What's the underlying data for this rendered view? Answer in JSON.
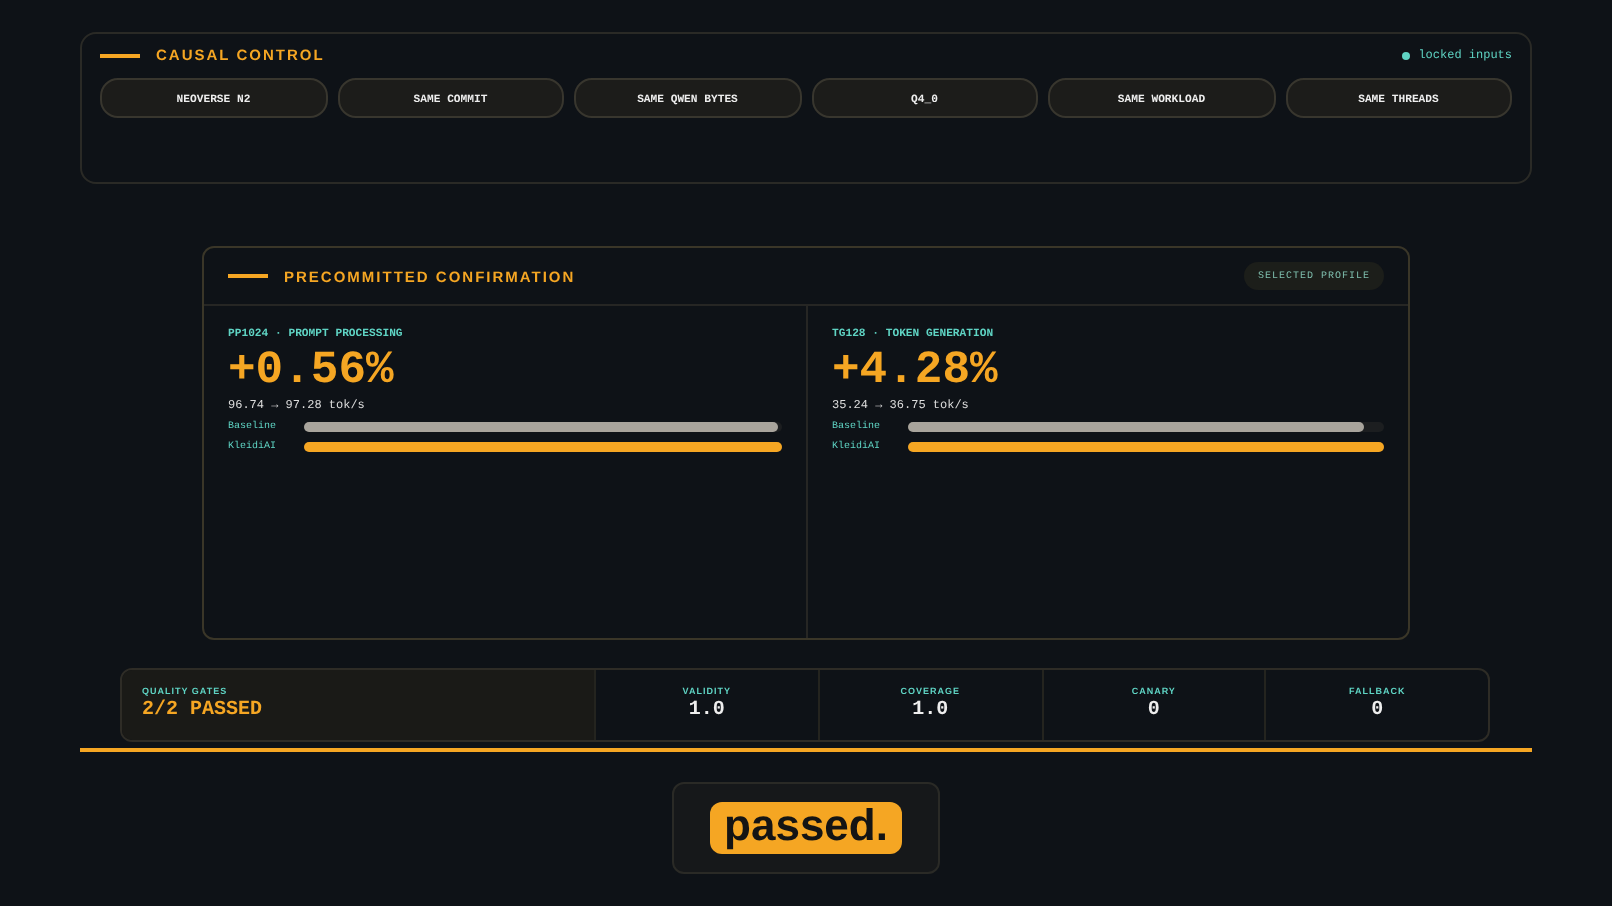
{
  "causal_control": {
    "title": "CAUSAL CONTROL",
    "status": "locked inputs",
    "chips": [
      "NEOVERSE N2",
      "SAME COMMIT",
      "SAME QWEN BYTES",
      "Q4_0",
      "SAME WORKLOAD",
      "SAME THREADS"
    ]
  },
  "confirmation": {
    "title": "PRECOMMITTED CONFIRMATION",
    "badge": "SELECTED PROFILE",
    "metrics": [
      {
        "label": "PP1024 · PROMPT PROCESSING",
        "delta": "+0.56%",
        "throughput": "96.74 → 97.28 tok/s",
        "bars": [
          {
            "name": "Baseline",
            "kind": "baseline",
            "level": 0.99
          },
          {
            "name": "KleidiAI",
            "kind": "kleidiai",
            "level": 1.0
          }
        ]
      },
      {
        "label": "TG128 · TOKEN GENERATION",
        "delta": "+4.28%",
        "throughput": "35.24 → 36.75 tok/s",
        "bars": [
          {
            "name": "Baseline",
            "kind": "baseline",
            "level": 0.96
          },
          {
            "name": "KleidiAI",
            "kind": "kleidiai",
            "level": 1.0
          }
        ]
      }
    ]
  },
  "quality_gates": {
    "label": "QUALITY GATES",
    "summary": "2/2 PASSED",
    "gates": [
      {
        "name": "VALIDITY",
        "value": "1.0"
      },
      {
        "name": "COVERAGE",
        "value": "1.0"
      },
      {
        "name": "CANARY",
        "value": "0"
      },
      {
        "name": "FALLBACK",
        "value": "0"
      }
    ]
  },
  "verdict": "passed."
}
